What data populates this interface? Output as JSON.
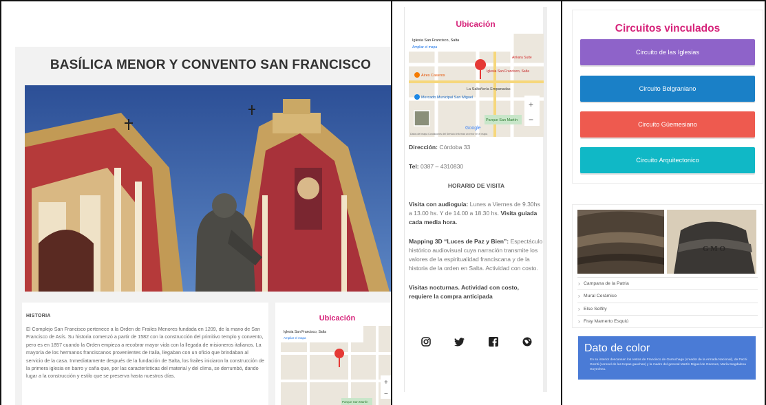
{
  "colors": {
    "accent_pink": "#d6237a",
    "btn_iglesias": "#8e63c9",
    "btn_belgraniano": "#1a80c7",
    "btn_guemesiano": "#ee5a4f",
    "btn_arquitectonico": "#10b8c6",
    "dato_bg": "#4a7bd6"
  },
  "panel1": {
    "title": "BASÍLICA MENOR Y CONVENTO SAN FRANCISCO",
    "history_heading": "HISTORIA",
    "history_text": "El Complejo San Francisco pertenece a la Orden de Frailes Menores fundada en 1209, de la mano de San Francisco de Asís. Su historia comenzó a partir de 1582 con la construcción del primitivo templo y convento, pero es en 1857 cuando la Orden empieza a recobrar mayor vida con la llegada de misioneros italianos. La mayoría de los hermanos franciscanos provenientes de Italia, llegaban con un oficio que brindaban al servicio de la casa. Inmediatamente después de la fundación de Salta, los frailes iniciaron la construcción de la primera iglesia en barro y caña que, por las características del material y del clima, se derrumbó, dando lugar a la construcción y estilo que se preserva hasta nuestros días.",
    "mini_location_title": "Ubicación"
  },
  "map": {
    "place_name": "Iglesia San Francisco, Salta",
    "enlarge_link": "Ampliar el mapa",
    "pin_label": "Iglesia San Francisco, Salta",
    "poi_1": "Aires Caseros",
    "poi_2": "La Salteñería Empanadas",
    "poi_3": "Mercado Municipal San Miguel",
    "poi_4": "Parque San Martín",
    "poi_5": "Ankara Suite",
    "brand": "Google",
    "zoom_in": "+",
    "zoom_out": "−",
    "footer": "Datos del mapa  Condiciones del Servicio  Informar un error en el mapa"
  },
  "panel2": {
    "location_title": "Ubicación",
    "direccion_label": "Dirección:",
    "direccion_value": "Córdoba 33",
    "tel_label": "Tel:",
    "tel_value": "0387 – 4310830",
    "horario_heading": "HORARIO DE VISITA",
    "audioguia_label": "Visita con audioguía:",
    "audioguia_text": "Lunes a Viernes de 9.30hs a 13.00 hs. Y de 14.00 a 18.30 hs.",
    "guiada_text": "Visita guiada cada media hora.",
    "mapping_label": "Mapping 3D “Luces de Paz y Bien”:",
    "mapping_text": "Espectáculo histórico audiovisual cuya narración transmite los valores de la espiritualidad franciscana y de la historia de la orden en Salta. Actividad con costo.",
    "nocturnas_text": "Visitas nocturnas. Actividad con costo, requiere la compra anticipada",
    "icons": [
      "instagram-icon",
      "twitter-icon",
      "facebook-icon",
      "globe-icon"
    ]
  },
  "panel3": {
    "circuitos_title": "Circuitos vinculados",
    "buttons": [
      {
        "label": "Circuito de las Iglesias"
      },
      {
        "label": "Circuito Belgraniano"
      },
      {
        "label": "Circuito Güemesiano"
      },
      {
        "label": "Circuito Arquitectonico"
      }
    ],
    "list": [
      "Campana de la Patria",
      "Mural Cerámico",
      "Else Selfity",
      "Fray Mamerto Esquiú"
    ],
    "dato_title": "Dato de color",
    "dato_text": "En su interior descansan los restos de Francisco de Gurruchaga (creador de la Armada Nacional), de Pachi Gorriti (coronel de las tropas gauchas) y la madre del general Martín Miguel de Güemes, María Magdalena Goyechea."
  }
}
